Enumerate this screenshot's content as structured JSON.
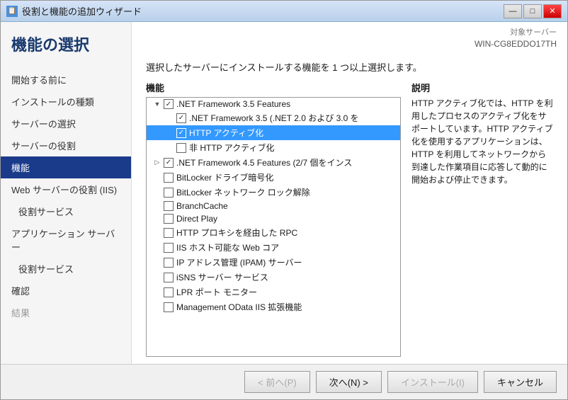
{
  "window": {
    "title": "役割と機能の追加ウィザード",
    "icon": "📋"
  },
  "titlebar_buttons": {
    "minimize": "—",
    "maximize": "□",
    "close": "✕"
  },
  "sidebar": {
    "page_title": "機能の選択",
    "items": [
      {
        "label": "開始する前に",
        "active": false,
        "sub": false,
        "disabled": false
      },
      {
        "label": "インストールの種類",
        "active": false,
        "sub": false,
        "disabled": false
      },
      {
        "label": "サーバーの選択",
        "active": false,
        "sub": false,
        "disabled": false
      },
      {
        "label": "サーバーの役割",
        "active": false,
        "sub": false,
        "disabled": false
      },
      {
        "label": "機能",
        "active": true,
        "sub": false,
        "disabled": false
      },
      {
        "label": "Web サーバーの役割 (IIS)",
        "active": false,
        "sub": false,
        "disabled": false
      },
      {
        "label": "役割サービス",
        "active": false,
        "sub": true,
        "disabled": false
      },
      {
        "label": "アプリケーション サーバー",
        "active": false,
        "sub": false,
        "disabled": false
      },
      {
        "label": "役割サービス",
        "active": false,
        "sub": true,
        "disabled": false
      },
      {
        "label": "確認",
        "active": false,
        "sub": false,
        "disabled": false
      },
      {
        "label": "結果",
        "active": false,
        "sub": false,
        "disabled": true
      }
    ]
  },
  "server_info": {
    "label": "対象サーバー",
    "value": "WIN-CG8EDDO17TH"
  },
  "content": {
    "instruction": "選択したサーバーにインストールする機能を 1 つ以上選択します。",
    "features_label": "機能",
    "description_label": "説明",
    "description_text": "HTTP アクティブ化では、HTTP を利用したプロセスのアクティブ化をサポートしています。HTTP アクティブ化を使用するアプリケーションは、HTTP を利用してネットワークから到達した作業項目に応答して動的に開始および停止できます。"
  },
  "features": [
    {
      "level": 0,
      "expand": "▼",
      "checked": true,
      "label": ".NET Framework 3.5 Features",
      "selected": false
    },
    {
      "level": 1,
      "expand": "",
      "checked": true,
      "label": ".NET Framework 3.5 (.NET 2.0 および 3.0 を",
      "selected": false
    },
    {
      "level": 1,
      "expand": "",
      "checked": true,
      "label": "HTTP アクティブ化",
      "selected": true
    },
    {
      "level": 1,
      "expand": "",
      "checked": false,
      "label": "非 HTTP アクティブ化",
      "selected": false
    },
    {
      "level": 0,
      "expand": "▷",
      "checked": true,
      "label": ".NET Framework 4.5 Features (2/7 個をインス",
      "selected": false
    },
    {
      "level": 0,
      "expand": "",
      "checked": false,
      "label": "BitLocker ドライブ暗号化",
      "selected": false
    },
    {
      "level": 0,
      "expand": "",
      "checked": false,
      "label": "BitLocker ネットワーク ロック解除",
      "selected": false
    },
    {
      "level": 0,
      "expand": "",
      "checked": false,
      "label": "BranchCache",
      "selected": false
    },
    {
      "level": 0,
      "expand": "",
      "checked": false,
      "label": "Direct Play",
      "selected": false
    },
    {
      "level": 0,
      "expand": "",
      "checked": false,
      "label": "HTTP プロキシを経由した RPC",
      "selected": false
    },
    {
      "level": 0,
      "expand": "",
      "checked": false,
      "label": "IIS ホスト可能な Web コア",
      "selected": false
    },
    {
      "level": 0,
      "expand": "",
      "checked": false,
      "label": "IP アドレス管理 (IPAM) サーバー",
      "selected": false
    },
    {
      "level": 0,
      "expand": "",
      "checked": false,
      "label": "iSNS サーバー サービス",
      "selected": false
    },
    {
      "level": 0,
      "expand": "",
      "checked": false,
      "label": "LPR ポート モニター",
      "selected": false
    },
    {
      "level": 0,
      "expand": "",
      "checked": false,
      "label": "Management OData IIS 拡張機能",
      "selected": false
    }
  ],
  "buttons": {
    "prev": "< 前へ(P)",
    "next": "次へ(N) >",
    "install": "インストール(I)",
    "cancel": "キャンセル"
  }
}
